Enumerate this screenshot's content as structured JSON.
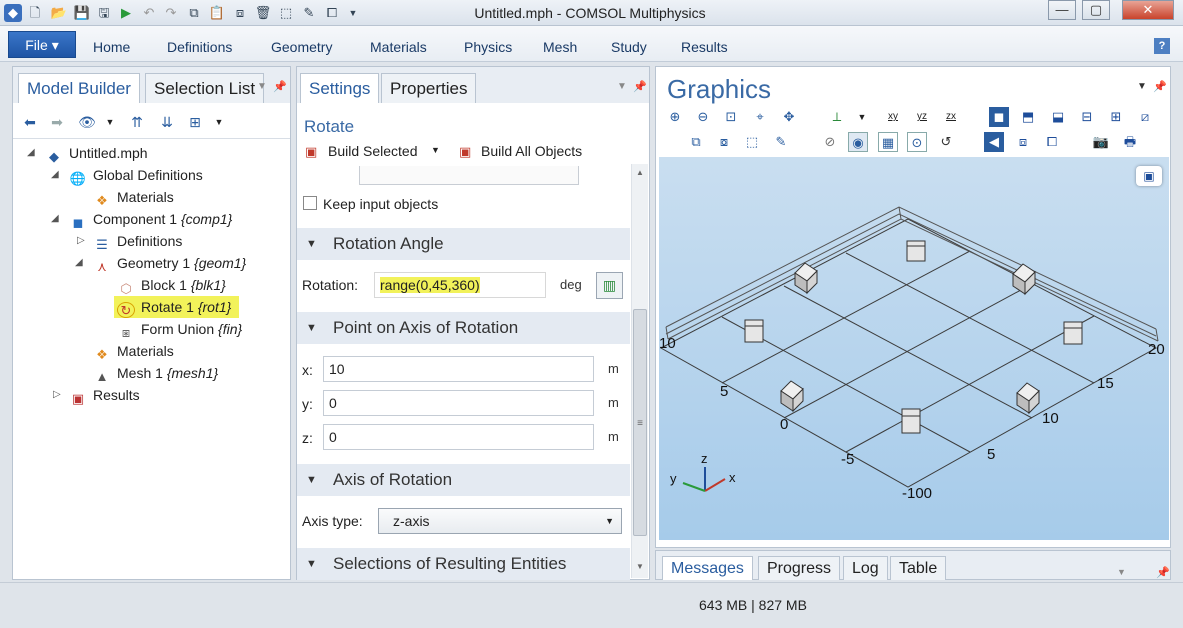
{
  "window": {
    "title": "Untitled.mph - COMSOL Multiphysics",
    "minimize": "—",
    "maximize": "▢",
    "close": "✕"
  },
  "menu": {
    "file": "File ▾",
    "items": [
      "Home",
      "Definitions",
      "Geometry",
      "Materials",
      "Physics",
      "Mesh",
      "Study",
      "Results"
    ],
    "help": "?"
  },
  "model_builder": {
    "tabs": [
      "Model Builder",
      "Selection List"
    ],
    "tree": [
      {
        "label": "Untitled.mph",
        "tag": ""
      },
      {
        "label": "Global Definitions",
        "tag": ""
      },
      {
        "label": "Materials",
        "tag": ""
      },
      {
        "label": "Component 1 ",
        "tag": "{comp1}"
      },
      {
        "label": "Definitions",
        "tag": ""
      },
      {
        "label": "Geometry 1 ",
        "tag": "{geom1}"
      },
      {
        "label": "Block 1 ",
        "tag": "{blk1}"
      },
      {
        "label": "Rotate 1 ",
        "tag": "{rot1}"
      },
      {
        "label": "Form Union ",
        "tag": "{fin}"
      },
      {
        "label": "Materials",
        "tag": ""
      },
      {
        "label": "Mesh 1 ",
        "tag": "{mesh1}"
      },
      {
        "label": "Results",
        "tag": ""
      }
    ]
  },
  "settings": {
    "tabs": [
      "Settings",
      "Properties"
    ],
    "node_title": "Rotate",
    "build_selected": "Build Selected",
    "build_all": "Build All Objects",
    "keep_input": "Keep input objects",
    "sections": {
      "rotation_angle": "Rotation Angle",
      "point_on_axis": "Point on Axis of Rotation",
      "axis_of_rotation": "Axis of Rotation",
      "selections": "Selections of Resulting Entities"
    },
    "rotation": {
      "label": "Rotation:",
      "value": "range(0,45,360)",
      "unit": "deg"
    },
    "point": {
      "x": {
        "label": "x:",
        "value": "10",
        "unit": "m"
      },
      "y": {
        "label": "y:",
        "value": "0",
        "unit": "m"
      },
      "z": {
        "label": "z:",
        "value": "0",
        "unit": "m"
      }
    },
    "axis_type": {
      "label": "Axis type:",
      "value": "z-axis"
    }
  },
  "graphics": {
    "title": "Graphics",
    "axis_labels": [
      "10",
      "5",
      "0",
      "-5",
      "-100",
      "5",
      "10",
      "15",
      "20"
    ],
    "triad": {
      "x": "x",
      "y": "y",
      "z": "z"
    },
    "colors": {
      "bg_top": "#c5dcf0",
      "bg_bottom": "#9fc6ea",
      "grid": "#4a4a4a",
      "blue": "#1e4d9a"
    }
  },
  "bottom_tabs": [
    "Messages",
    "Progress",
    "Log",
    "Table"
  ],
  "status": {
    "memory": "643 MB | 827 MB"
  }
}
